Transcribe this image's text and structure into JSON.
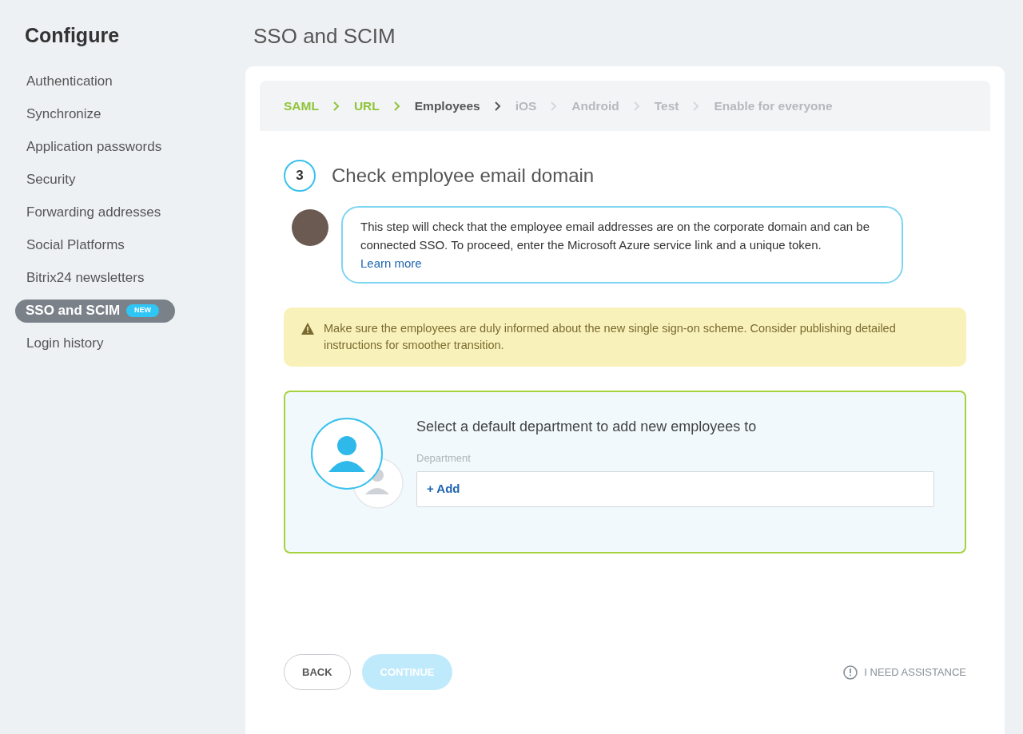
{
  "sidebar": {
    "title": "Configure",
    "items": [
      {
        "label": "Authentication",
        "selected": false
      },
      {
        "label": "Synchronize",
        "selected": false
      },
      {
        "label": "Application passwords",
        "selected": false
      },
      {
        "label": "Security",
        "selected": false
      },
      {
        "label": "Forwarding addresses",
        "selected": false
      },
      {
        "label": "Social Platforms",
        "selected": false
      },
      {
        "label": "Bitrix24 newsletters",
        "selected": false
      },
      {
        "label": "SSO and SCIM",
        "selected": true,
        "badge": "NEW"
      },
      {
        "label": "Login history",
        "selected": false
      }
    ]
  },
  "page_title": "SSO and SCIM",
  "steps": [
    {
      "label": "SAML",
      "done": true,
      "selected": false
    },
    {
      "label": "URL",
      "done": true,
      "selected": false
    },
    {
      "label": "Employees",
      "done": false,
      "selected": true
    },
    {
      "label": "iOS",
      "done": false,
      "selected": false
    },
    {
      "label": "Android",
      "done": false,
      "selected": false
    },
    {
      "label": "Test",
      "done": false,
      "selected": false
    },
    {
      "label": "Enable for everyone",
      "done": false,
      "selected": false
    }
  ],
  "step": {
    "number": "3",
    "title": "Check employee email domain"
  },
  "hint": {
    "text": "This step will check that the employee email addresses are on the corporate domain and can be connected SSO. To proceed, enter the Microsoft Azure service link and a unique token.",
    "link": "Learn more"
  },
  "warning": "Make sure the employees are duly informed about the new single sign-on scheme. Consider publishing detailed instructions for smoother transition.",
  "department": {
    "heading": "Select a default department to add new employees to",
    "label": "Department",
    "add": "+ Add"
  },
  "buttons": [
    {
      "label": "BACK",
      "kind": "secondary",
      "disabled": false
    },
    {
      "label": "CONTINUE",
      "kind": "primary",
      "disabled": true
    }
  ],
  "assistance": "I NEED ASSISTANCE"
}
